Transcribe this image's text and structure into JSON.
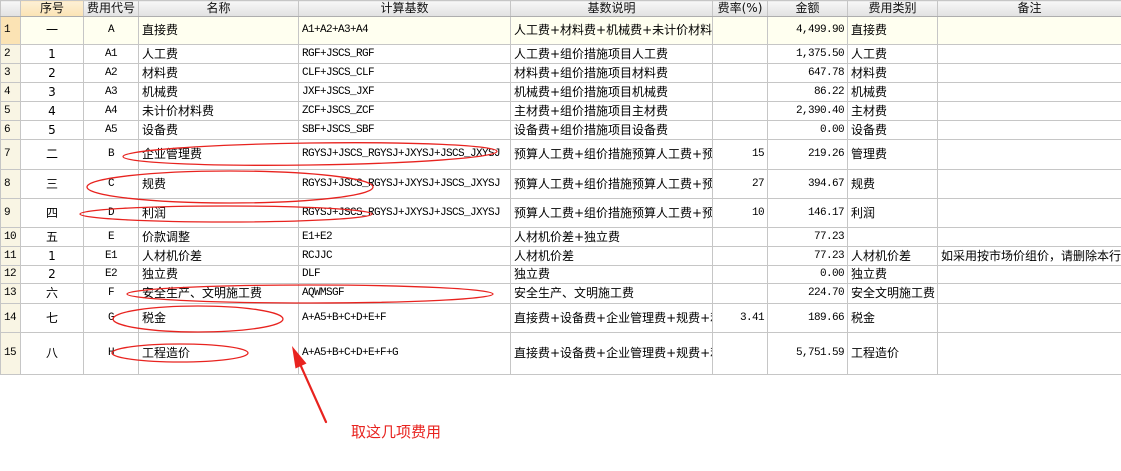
{
  "header": {
    "seq": "序号",
    "code": "费用代号",
    "name": "名称",
    "base": "计算基数",
    "base_desc": "基数说明",
    "rate": "费率(%)",
    "amount": "金额",
    "category": "费用类别",
    "remark": "备注"
  },
  "rows": [
    {
      "no": "1",
      "seq": "一",
      "code": "A",
      "name": "直接费",
      "base": "A1+A2+A3+A4",
      "base_desc": "人工费+材料费+机械费+未计价材料费",
      "rate": "",
      "amount": "4,499.90",
      "category": "直接费",
      "remark": ""
    },
    {
      "no": "2",
      "seq": "1",
      "code": "A1",
      "name": "人工费",
      "base": "RGF+JSCS_RGF",
      "base_desc": "人工费+组价措施项目人工费",
      "rate": "",
      "amount": "1,375.50",
      "category": "人工费",
      "remark": ""
    },
    {
      "no": "3",
      "seq": "2",
      "code": "A2",
      "name": "材料费",
      "base": "CLF+JSCS_CLF",
      "base_desc": "材料费+组价措施项目材料费",
      "rate": "",
      "amount": "647.78",
      "category": "材料费",
      "remark": ""
    },
    {
      "no": "4",
      "seq": "3",
      "code": "A3",
      "name": "机械费",
      "base": "JXF+JSCS_JXF",
      "base_desc": "机械费+组价措施项目机械费",
      "rate": "",
      "amount": "86.22",
      "category": "机械费",
      "remark": ""
    },
    {
      "no": "5",
      "seq": "4",
      "code": "A4",
      "name": "未计价材料费",
      "base": "ZCF+JSCS_ZCF",
      "base_desc": "主材费+组价措施项目主材费",
      "rate": "",
      "amount": "2,390.40",
      "category": "主材费",
      "remark": ""
    },
    {
      "no": "6",
      "seq": "5",
      "code": "A5",
      "name": "设备费",
      "base": "SBF+JSCS_SBF",
      "base_desc": "设备费+组价措施项目设备费",
      "rate": "",
      "amount": "0.00",
      "category": "设备费",
      "remark": ""
    },
    {
      "no": "7",
      "seq": "二",
      "code": "B",
      "name": "企业管理费",
      "base": "RGYSJ+JSCS_RGYSJ+JXYSJ+JSCS_JXYSJ",
      "base_desc": "预算人工费+组价措施预算人工费+预算机械费+组价措施预算机械费",
      "rate": "15",
      "amount": "219.26",
      "category": "管理费",
      "remark": ""
    },
    {
      "no": "8",
      "seq": "三",
      "code": "C",
      "name": "规费",
      "base": "RGYSJ+JSCS_RGYSJ+JXYSJ+JSCS_JXYSJ",
      "base_desc": "预算人工费+组价措施预算人工费+预算机械费+组价措施预算机械费",
      "rate": "27",
      "amount": "394.67",
      "category": "规费",
      "remark": ""
    },
    {
      "no": "9",
      "seq": "四",
      "code": "D",
      "name": "利润",
      "base": "RGYSJ+JSCS_RGYSJ+JXYSJ+JSCS_JXYSJ",
      "base_desc": "预算人工费+组价措施预算人工费+预算机械费+组价措施预算机械费",
      "rate": "10",
      "amount": "146.17",
      "category": "利润",
      "remark": ""
    },
    {
      "no": "10",
      "seq": "五",
      "code": "E",
      "name": "价款调整",
      "base": "E1+E2",
      "base_desc": "人材机价差+独立费",
      "rate": "",
      "amount": "77.23",
      "category": "",
      "remark": ""
    },
    {
      "no": "11",
      "seq": "1",
      "code": "E1",
      "name": "人材机价差",
      "base": "RCJJC",
      "base_desc": "人材机价差",
      "rate": "",
      "amount": "77.23",
      "category": "人材机价差",
      "remark": "如采用按市场价组价，请删除本行"
    },
    {
      "no": "12",
      "seq": "2",
      "code": "E2",
      "name": "独立费",
      "base": "DLF",
      "base_desc": "独立费",
      "rate": "",
      "amount": "0.00",
      "category": "独立费",
      "remark": ""
    },
    {
      "no": "13",
      "seq": "六",
      "code": "F",
      "name": "安全生产、文明施工费",
      "base": "AQWMSGF",
      "base_desc": "安全生产、文明施工费",
      "rate": "",
      "amount": "224.70",
      "category": "安全文明施工费",
      "remark": ""
    },
    {
      "no": "14",
      "seq": "七",
      "code": "G",
      "name": "税金",
      "base": "A+A5+B+C+D+E+F",
      "base_desc": "直接费+设备费+企业管理费+规费+利润+价款调整+安全生产、文明施工费",
      "rate": "3.41",
      "amount": "189.66",
      "category": "税金",
      "remark": ""
    },
    {
      "no": "15",
      "seq": "八",
      "code": "H",
      "name": "工程造价",
      "base": "A+A5+B+C+D+E+F+G",
      "base_desc": "直接费+设备费+企业管理费+规费+利润+价款调整+安全生产、文明施工费+税金",
      "rate": "",
      "amount": "5,751.59",
      "category": "工程造价",
      "remark": ""
    }
  ],
  "annotation": {
    "note": "取这几项费用"
  },
  "colors": {
    "annotation_red": "#e8231f",
    "grid_line": "#c6c6c6",
    "row_header_bg": "#f9f5e4",
    "selected_row_bg": "#fffff0",
    "current_header_bg": "#fbe3b4"
  }
}
